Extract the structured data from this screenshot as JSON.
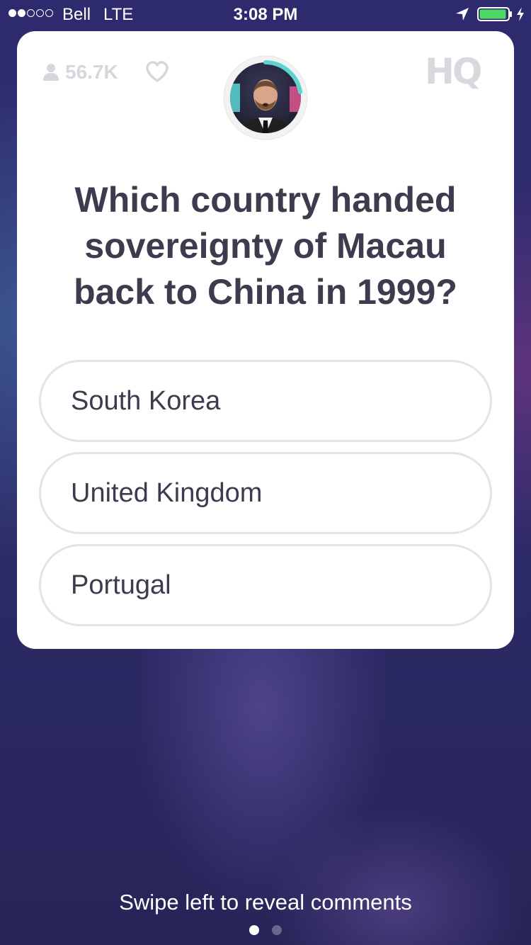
{
  "status_bar": {
    "signal": {
      "filled": 2,
      "total": 5
    },
    "carrier": "Bell",
    "network": "LTE",
    "time": "3:08 PM",
    "icons": [
      "location-arrow-icon",
      "battery-icon",
      "charging-bolt-icon"
    ],
    "battery_level": 0.95,
    "battery_color": "#4cd964"
  },
  "card": {
    "viewer_count": "56.7K",
    "logo": "HQ",
    "host_avatar": {
      "timer_color": "#5fd3d0"
    },
    "question": "Which country handed sovereignty of Macau back to China in 1999?",
    "answers": [
      {
        "label": "South Korea"
      },
      {
        "label": "United Kingdom"
      },
      {
        "label": "Portugal"
      }
    ]
  },
  "footer": {
    "swipe_hint": "Swipe left to reveal comments",
    "pages": {
      "count": 2,
      "active": 0
    }
  },
  "colors": {
    "card_bg": "#ffffff",
    "text": "#3d3b4d",
    "muted": "#d6d6dc",
    "answer_border": "#e4e4e4",
    "background": "#2d2a6e"
  }
}
